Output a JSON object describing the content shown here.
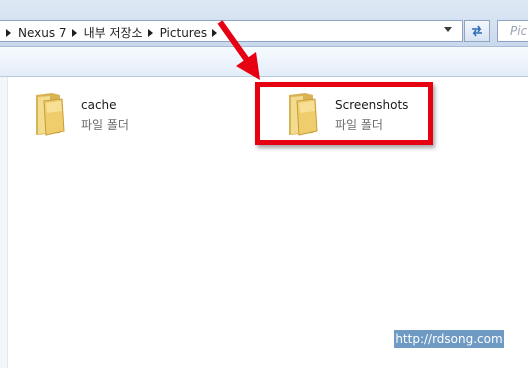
{
  "address_bar": {
    "crumbs": [
      "Nexus 7",
      "내부 저장소",
      "Pictures"
    ]
  },
  "search": {
    "placeholder": "Pict"
  },
  "icons": {
    "refresh": "refresh-icon",
    "folder": "folder-icon",
    "dropdown": "chevron-down-icon"
  },
  "items": [
    {
      "name": "cache",
      "type": "파일 폴더"
    },
    {
      "name": "Screenshots",
      "type": "파일 폴더"
    }
  ],
  "annotation": {
    "color": "#e60012"
  },
  "watermark": "http://rdsong.com"
}
